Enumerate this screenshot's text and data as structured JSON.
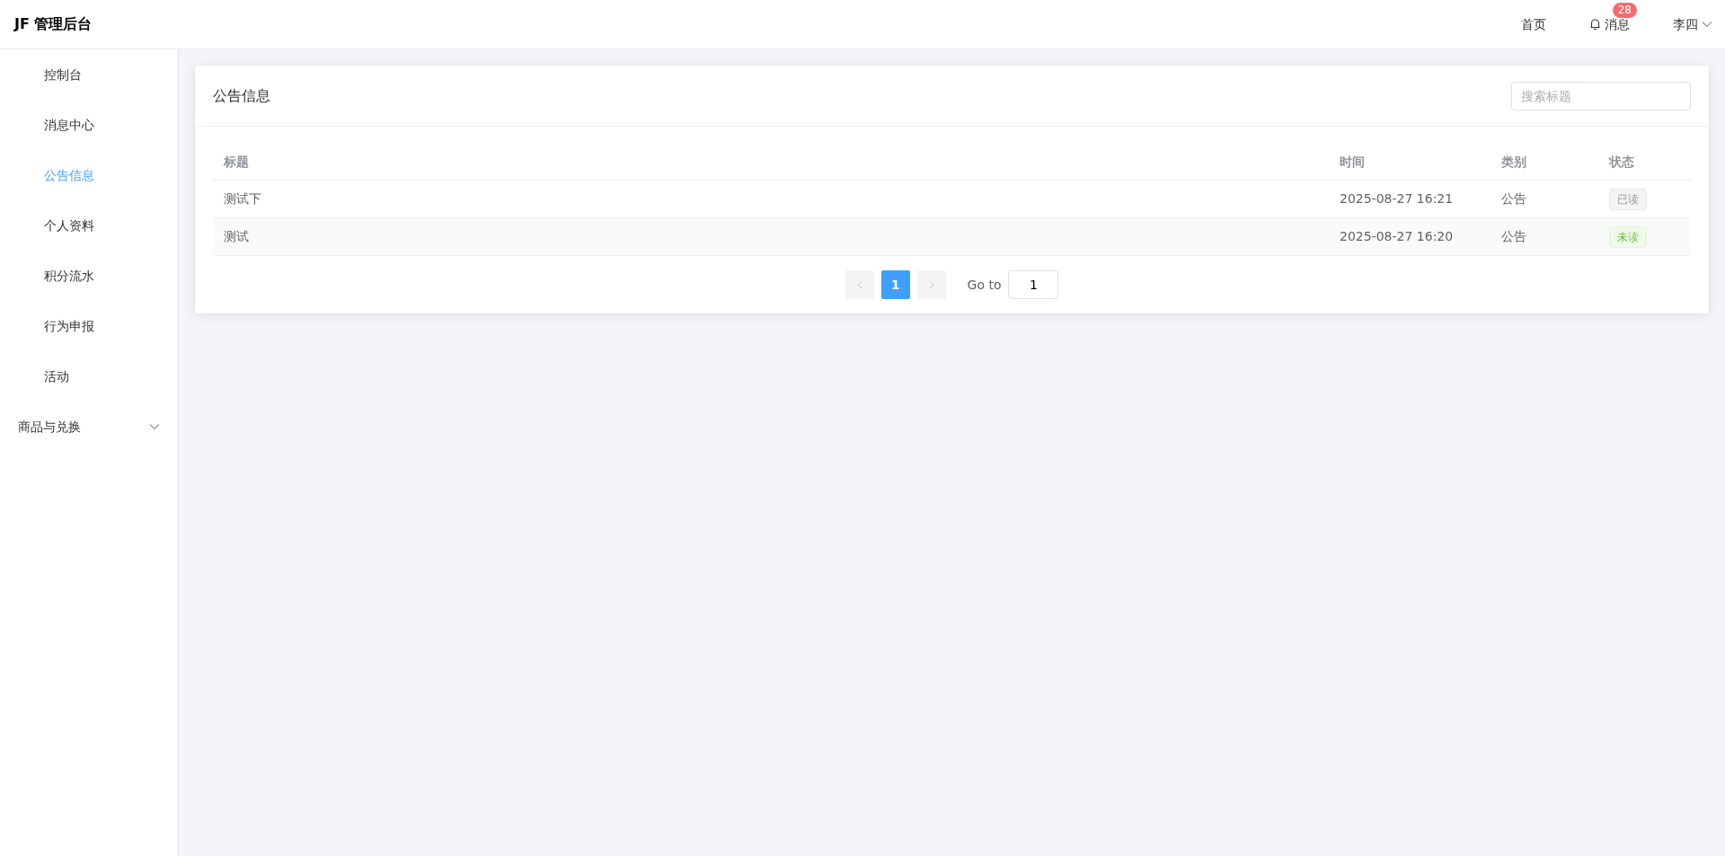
{
  "header": {
    "logo": "JF 管理后台",
    "nav": [
      {
        "label": "首页",
        "kind": "link"
      },
      {
        "label": "消息",
        "kind": "bell",
        "badge": "28"
      }
    ],
    "user": "李四"
  },
  "sidebar": {
    "items": [
      {
        "label": "控制台",
        "kind": "item",
        "selected": false
      },
      {
        "label": "消息中心",
        "kind": "item",
        "selected": false
      },
      {
        "label": "公告信息",
        "kind": "item",
        "selected": true
      },
      {
        "label": "个人资料",
        "kind": "item",
        "selected": false
      },
      {
        "label": "积分流水",
        "kind": "item",
        "selected": false
      },
      {
        "label": "行为申报",
        "kind": "item",
        "selected": false
      },
      {
        "label": "活动",
        "kind": "item",
        "selected": false
      },
      {
        "label": "商品与兑换",
        "kind": "submenu",
        "selected": false,
        "expanded": false
      }
    ]
  },
  "card": {
    "title": "公告信息",
    "search": {
      "placeholder": "搜索标题"
    }
  },
  "table": {
    "columns": [
      "标题",
      "时间",
      "类别",
      "状态"
    ],
    "rows": [
      {
        "title": "测试下",
        "time": "2025-08-27 16:21",
        "category": "公告",
        "status": "已读",
        "read": true
      },
      {
        "title": "测试",
        "time": "2025-08-27 16:20",
        "category": "公告",
        "status": "未读",
        "read": false
      }
    ]
  },
  "pagination": {
    "prev_disabled": true,
    "next_disabled": true,
    "pages": [
      {
        "label": "1",
        "selected": true
      }
    ],
    "goto_label": "Go to",
    "goto_value": "1"
  }
}
